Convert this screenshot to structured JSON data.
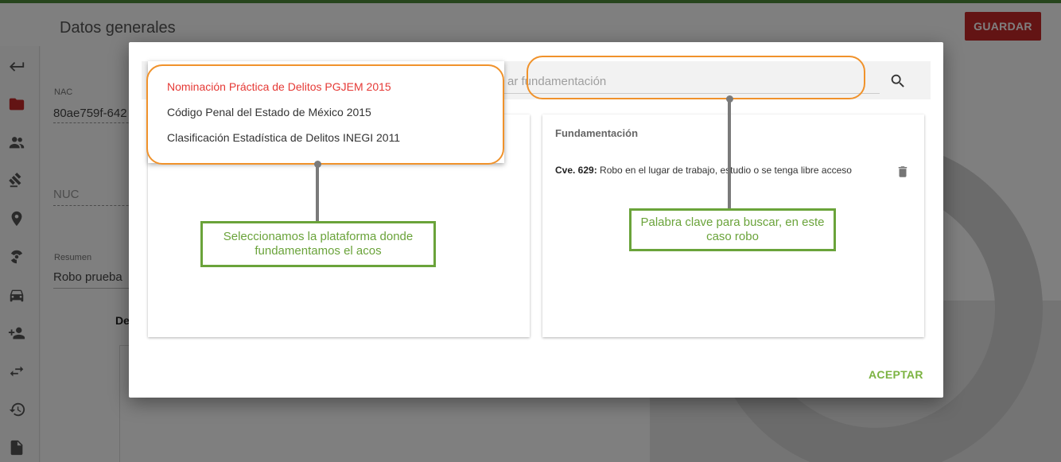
{
  "app": {
    "title": "Datos generales",
    "save_label": "GUARDAR"
  },
  "form": {
    "nac_label": "NAC",
    "nac_value": "80ae759f-642",
    "nuc_placeholder": "NUC",
    "summary_label": "Resumen",
    "summary_value": "Robo prueba",
    "section_fragment": "De"
  },
  "sidebar": {
    "icons": [
      "back-arrow-icon",
      "folder-icon",
      "people-icon",
      "gavel-icon",
      "location-icon",
      "hazard-icon",
      "car-icon",
      "add-person-icon",
      "swap-icon",
      "history-icon",
      "document-icon"
    ],
    "active_color": "#c62828"
  },
  "dialog": {
    "search_placeholder": "ar fundamentación",
    "platforms": [
      "Nominación Práctica de Delitos PGJEM 2015",
      "Código Penal del Estado de México 2015",
      "Clasificación Estadística de Delitos INEGI 2011"
    ],
    "selected_platform_index": 0,
    "fundamentacion_title": "Fundamentación",
    "fundamentacion_items": [
      {
        "key": "Cve. 629:",
        "text": "Robo en el lugar de trabajo, estudio o se tenga libre acceso"
      }
    ],
    "accept_label": "ACEPTAR"
  },
  "annotations": {
    "platform_note": "Seleccionamos la plataforma donde fundamentamos el acos",
    "keyword_note": "Palabra clave para buscar, en este caso robo"
  },
  "colors": {
    "primary_red": "#c62828",
    "selected_item": "#e53935",
    "accept_green": "#7cb342",
    "annotation_orange": "#f0922b",
    "annotation_green": "#6aa33a",
    "brand_bar": "#4f8a3a"
  }
}
